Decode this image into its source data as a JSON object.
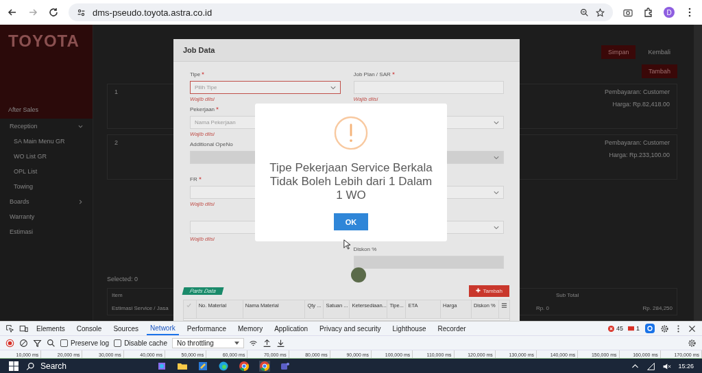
{
  "browser": {
    "url": "dms-pseudo.toyota.astra.co.id",
    "profile_initial": "D"
  },
  "app": {
    "logo": "TOYOTA",
    "sidebar": {
      "section": "After Sales",
      "items": [
        {
          "label": "Reception",
          "kind": "group",
          "expanded": true,
          "children": [
            {
              "label": "SA Main Menu GR"
            },
            {
              "label": "WO List GR"
            },
            {
              "label": "OPL List"
            },
            {
              "label": "Towing"
            }
          ]
        },
        {
          "label": "Boards",
          "kind": "group",
          "expanded": false
        },
        {
          "label": "Warranty",
          "kind": "link"
        },
        {
          "label": "Estimasi",
          "kind": "link"
        }
      ]
    },
    "header_buttons": [
      {
        "label": "Simpan",
        "kind": "primary"
      },
      {
        "label": "Kembali",
        "kind": "plain"
      }
    ],
    "add_button": "Tambah",
    "jobs": [
      {
        "number": "1",
        "payment": "Pembayaran: Customer",
        "price": "Harga: Rp.82,418.00"
      },
      {
        "number": "2",
        "payment": "Pembayaran: Customer",
        "price": "Harga: Rp.233,100.00"
      }
    ],
    "selected_count": "Selected: 0",
    "summary": {
      "columns": [
        "Item",
        "Sub Total"
      ],
      "row": [
        "Estimasi Service / Jasa",
        "Rp. 0",
        "Rp. 284,250"
      ]
    }
  },
  "job_modal": {
    "title": "Job Data",
    "left_fields": [
      {
        "label": "Tipe",
        "required": true,
        "kind": "select",
        "placeholder": "Pilih Tipe",
        "error": "Wajib diisi",
        "invalid": true,
        "disabled": false
      },
      {
        "label": "Pekerjaan",
        "required": true,
        "kind": "input",
        "placeholder": "Nama Pekerjaan",
        "error": "Wajib diisi",
        "invalid": false,
        "disabled": false
      },
      {
        "label": "Additional OpeNo",
        "required": false,
        "kind": "input",
        "invalid": false,
        "disabled": true
      },
      {
        "label": "FR",
        "required": true,
        "kind": "input",
        "error": "Wajib diisi",
        "invalid": false,
        "disabled": false
      },
      {
        "kind": "input",
        "error": "Wajib diisi",
        "invalid": false,
        "disabled": false
      }
    ],
    "right_fields": [
      {
        "label": "Job Plan / SAR",
        "required": true,
        "kind": "input",
        "error": "Wajib diisi",
        "invalid": false,
        "disabled": false
      },
      {
        "kind": "select",
        "invalid": false,
        "disabled": false
      },
      {
        "kind": "select",
        "invalid": false,
        "disabled": true
      },
      {
        "kind": "select",
        "invalid": false,
        "disabled": false
      },
      {
        "kind": "select",
        "invalid": false,
        "disabled": false
      },
      {
        "label": "Diskon %",
        "required": false,
        "kind": "input",
        "invalid": false,
        "disabled": true
      }
    ],
    "parts": {
      "tag": "Parts Data",
      "add_button": "Tambah",
      "columns": [
        "No. Material",
        "Nama Material",
        "Qty ...",
        "Satuan ...",
        "Ketersediaan...",
        "Tipe...",
        "ETA",
        "Harga",
        "Diskon %"
      ]
    }
  },
  "alert": {
    "message": "Tipe Pekerjaan Service Berkala Tidak Boleh Lebih dari 1 Dalam 1 WO",
    "button": "OK"
  },
  "devtools": {
    "tabs": [
      {
        "label": "Elements",
        "selected": false
      },
      {
        "label": "Console",
        "selected": false
      },
      {
        "label": "Sources",
        "selected": false
      },
      {
        "label": "Network",
        "selected": true
      },
      {
        "label": "Performance",
        "selected": false
      },
      {
        "label": "Memory",
        "selected": false
      },
      {
        "label": "Application",
        "selected": false
      },
      {
        "label": "Privacy and security",
        "selected": false
      },
      {
        "label": "Lighthouse",
        "selected": false
      },
      {
        "label": "Recorder",
        "selected": false
      }
    ],
    "error_count": "45",
    "issue_count": "1",
    "checkboxes": [
      {
        "label": "Preserve log",
        "checked": false
      },
      {
        "label": "Disable cache",
        "checked": false
      }
    ],
    "throttling": "No throttling",
    "timeline": [
      "10,000 ms",
      "20,000 ms",
      "30,000 ms",
      "40,000 ms",
      "50,000 ms",
      "60,000 ms",
      "70,000 ms",
      "80,000 ms",
      "90,000 ms",
      "100,000 ms",
      "110,000 ms",
      "120,000 ms",
      "130,000 ms",
      "140,000 ms",
      "150,000 ms",
      "160,000 ms",
      "170,000 ms"
    ]
  },
  "taskbar": {
    "search": "Search",
    "time": "15:26"
  }
}
